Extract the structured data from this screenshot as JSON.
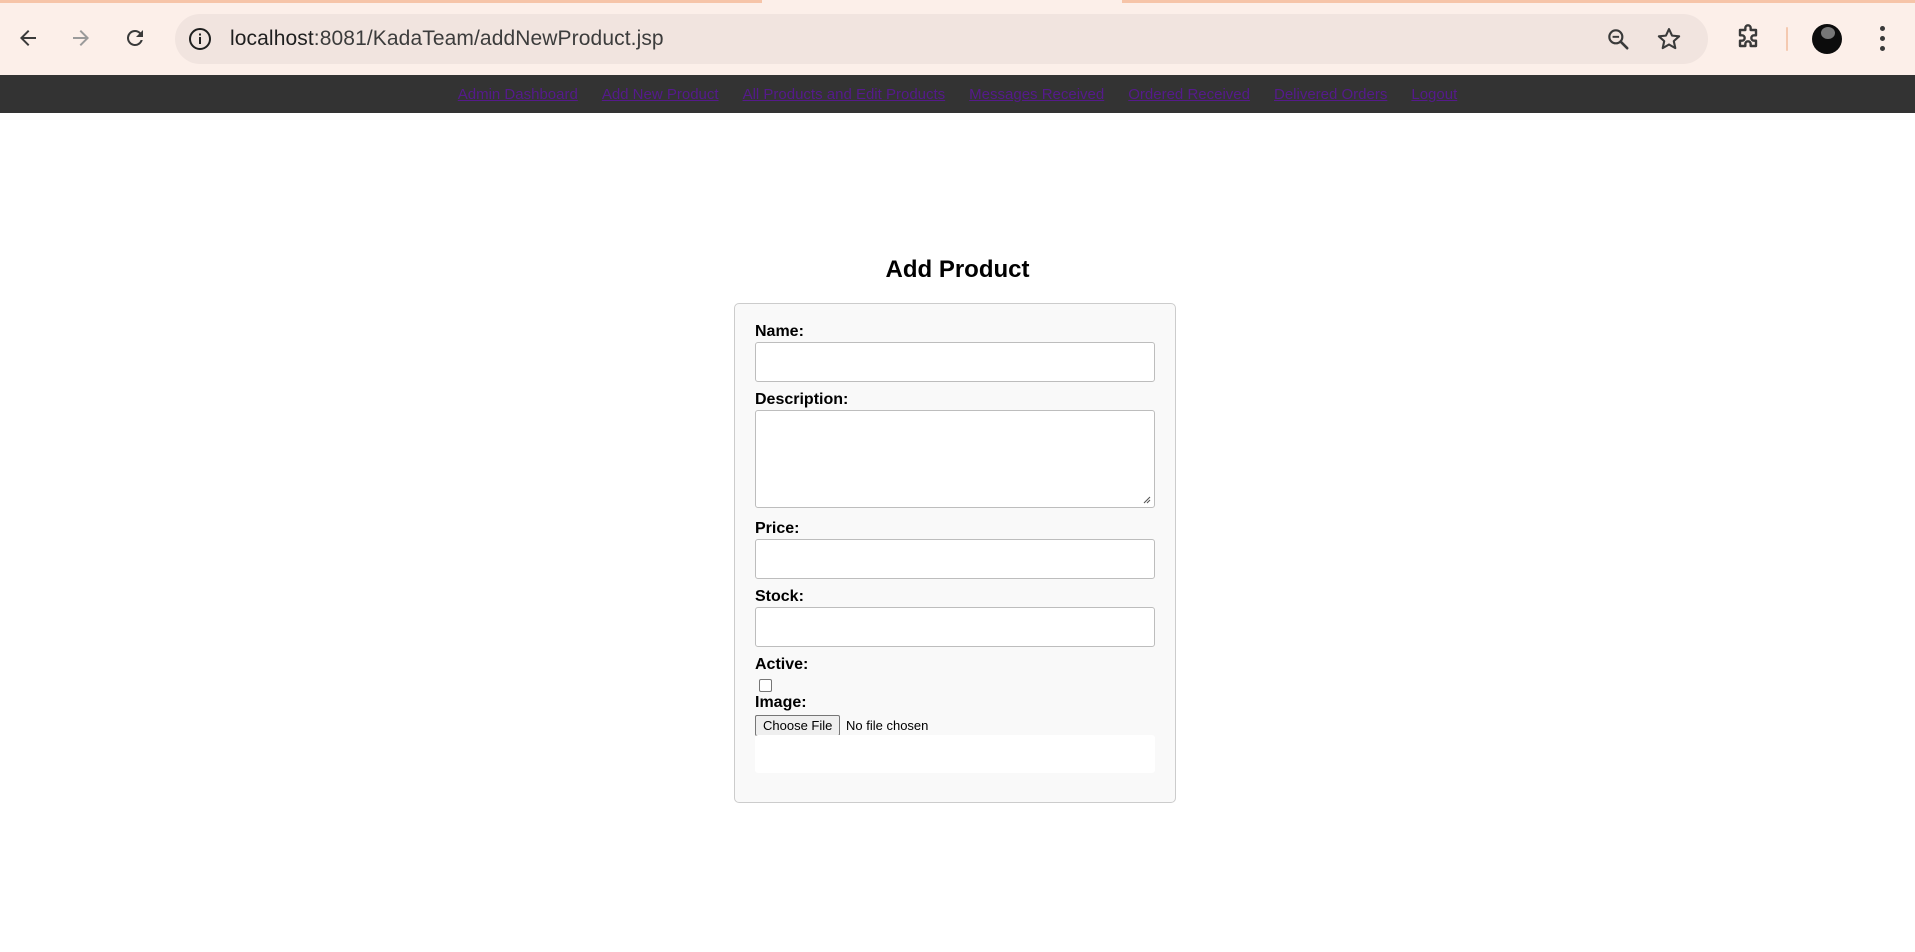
{
  "browser": {
    "url_host": "localhost",
    "url_path": ":8081/KadaTeam/addNewProduct.jsp"
  },
  "nav": {
    "links": [
      "Admin Dashboard",
      "Add New Product",
      "All Products and Edit Products",
      "Messages Received",
      "Ordered Received",
      "Delivered Orders",
      "Logout"
    ]
  },
  "form": {
    "title": "Add Product",
    "name_label": "Name:",
    "description_label": "Description:",
    "price_label": "Price:",
    "stock_label": "Stock:",
    "active_label": "Active:",
    "image_label": "Image:",
    "file_button": "Choose File",
    "file_status": "No file chosen"
  },
  "colors": {
    "chrome_bg": "#fcefe9",
    "navbar_bg": "#333333",
    "link": "#551a8b",
    "card_bg": "#f9f9f9"
  }
}
